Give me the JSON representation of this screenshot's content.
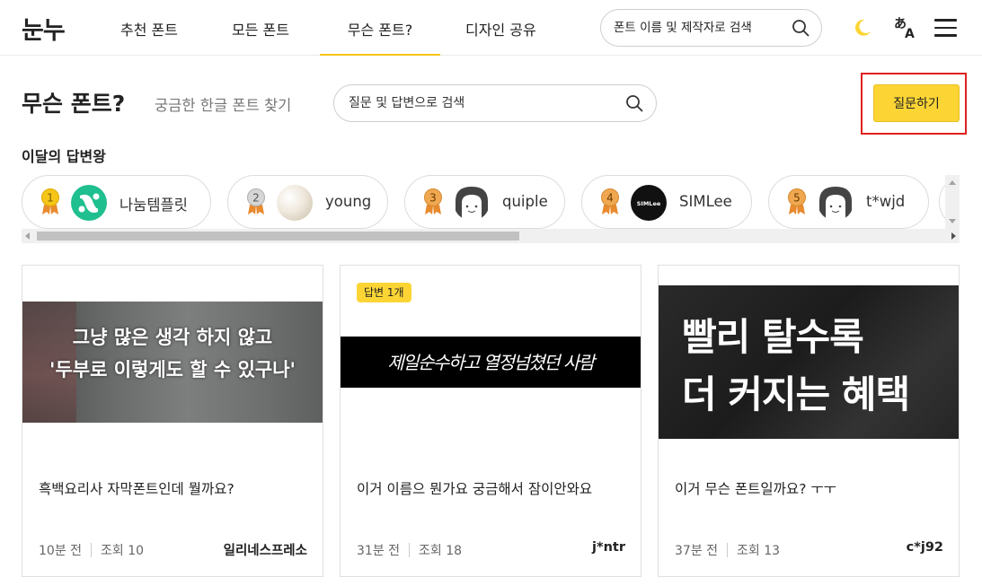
{
  "header": {
    "logo": "눈누",
    "nav": [
      "추천 폰트",
      "모든 폰트",
      "무슨 폰트?",
      "디자인 공유"
    ],
    "search_placeholder": "폰트 이름 및 제작자로 검색",
    "icons": [
      "search-icon",
      "moon-icon",
      "translate-icon",
      "menu-icon"
    ],
    "accent_color": "#f5c518"
  },
  "page": {
    "title": "무슨 폰트?",
    "subtitle": "궁금한 한글 폰트 찾기",
    "search_placeholder": "질문 및 답변으로 검색",
    "ask_button": "질문하기"
  },
  "kings": {
    "title": "이달의 답변왕",
    "items": [
      {
        "rank": "1",
        "name": "나눔템플릿"
      },
      {
        "rank": "2",
        "name": "young"
      },
      {
        "rank": "3",
        "name": "quiple"
      },
      {
        "rank": "4",
        "name": "SIMLee"
      },
      {
        "rank": "5",
        "name": "t*wjd"
      }
    ],
    "avatar_text_4": "SIMLee"
  },
  "cards": [
    {
      "thumb_line1": "그냥 많은 생각 하지 않고",
      "thumb_line2": "'두부로 이렇게도 할 수 있구나'",
      "title": "흑백요리사 자막폰트인데 뭘까요?",
      "time": "10분 전",
      "views": "조회 10",
      "author": "일리네스프레소"
    },
    {
      "badge": "답변 1개",
      "thumb_line1": "제일순수하고 열정넘쳤던 사람",
      "title": "이거 이름으 뭔가요 궁금해서 잠이안와요",
      "time": "31분 전",
      "views": "조회 18",
      "author": "j*ntr"
    },
    {
      "thumb_line1": "빨리 탈수록",
      "thumb_line2": "더 커지는 혜택",
      "title": "이거 무슨 폰트일까요? ㅜㅜ",
      "time": "37분 전",
      "views": "조회 13",
      "author": "c*j92"
    }
  ]
}
